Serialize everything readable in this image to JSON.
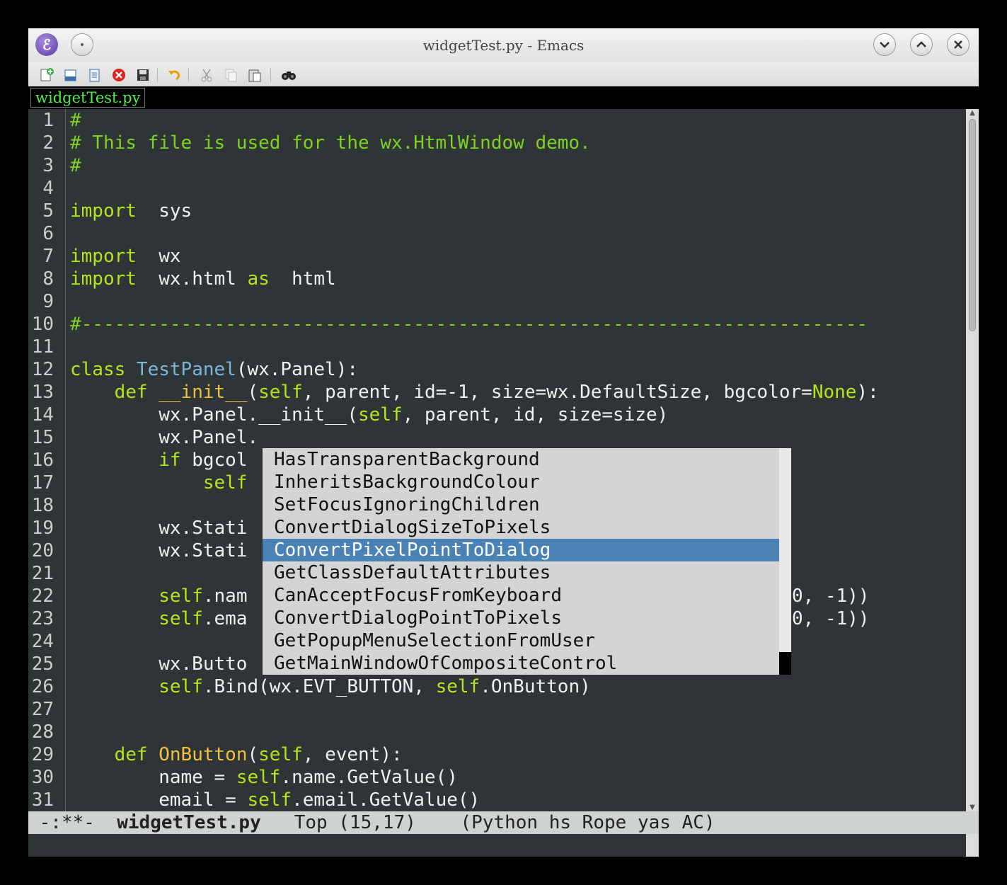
{
  "window": {
    "title": "widgetTest.py - Emacs"
  },
  "toolbar": {
    "icons": [
      "new-file-icon",
      "open-file-icon",
      "open-directory-icon",
      "close-buffer-icon",
      "save-icon",
      "undo-icon",
      "cut-icon",
      "copy-icon",
      "paste-icon",
      "search-icon"
    ]
  },
  "tab": {
    "label": "widgetTest.py"
  },
  "gutter": {
    "numbers": [
      "1",
      "2",
      "3",
      "4",
      "5",
      "6",
      "7",
      "8",
      "9",
      "10",
      "11",
      "12",
      "13",
      "14",
      "15",
      "16",
      "17",
      "18",
      "19",
      "20",
      "21",
      "22",
      "23",
      "24",
      "25",
      "26",
      "27",
      "28",
      "29",
      "30",
      "31"
    ]
  },
  "code": {
    "l1": "#",
    "l2": "# This file is used for the wx.HtmlWindow demo.",
    "l3": "#",
    "l5_kw": "import",
    "l5_rest": "  sys",
    "l7_kw": "import",
    "l7_rest": "  wx",
    "l8_kw": "import",
    "l8_mid": "  wx.html ",
    "l8_as": "as",
    "l8_rest": "  html",
    "l10": "#-----------------------------------------------------------------------",
    "l12_kw": "class ",
    "l12_cls": "TestPanel",
    "l12_rest": "(wx.Panel):",
    "l13_indent": "    ",
    "l13_def": "def ",
    "l13_fn": "__init__",
    "l13_p1": "(",
    "l13_self": "self",
    "l13_p2": ", parent, id=-1, size=wx.DefaultSize, bgcolor=",
    "l13_none": "None",
    "l13_p3": "):",
    "l14_a": "        wx.Panel.__init__(",
    "l14_self": "self",
    "l14_b": ", parent, id, size=size)",
    "l15": "        wx.Panel.",
    "l16_indent": "        ",
    "l16_kw": "if",
    "l16_rest": " bgcol",
    "l17_indent": "            ",
    "l17_self": "self",
    "l19": "        wx.Stati",
    "l20": "        wx.Stati",
    "l22_indent": "        ",
    "l22_self": "self",
    "l22_rest": ".nam",
    "l22_tail": "0, -1))",
    "l23_indent": "        ",
    "l23_self": "self",
    "l23_rest": ".ema",
    "l23_tail": "0, -1))",
    "l25": "        wx.Butto",
    "l26_indent": "        ",
    "l26_self1": "self",
    "l26_mid": ".Bind(wx.EVT_BUTTON, ",
    "l26_self2": "self",
    "l26_rest": ".OnButton)",
    "l29_indent": "    ",
    "l29_def": "def ",
    "l29_fn": "OnButton",
    "l29_p1": "(",
    "l29_self": "self",
    "l29_p2": ", event):",
    "l30_a": "        name = ",
    "l30_self": "self",
    "l30_b": ".name.GetValue()",
    "l31_a": "        email = ",
    "l31_self": "self",
    "l31_b": ".email.GetValue()"
  },
  "completion": {
    "selected_index": 4,
    "candidates": [
      "HasTransparentBackground",
      "InheritsBackgroundColour",
      "SetFocusIgnoringChildren",
      "ConvertDialogSizeToPixels",
      "ConvertPixelPointToDialog",
      "GetClassDefaultAttributes",
      "CanAcceptFocusFromKeyboard",
      "ConvertDialogPointToPixels",
      "GetPopupMenuSelectionFromUser",
      "GetMainWindowOfCompositeControl"
    ]
  },
  "modeline": {
    "status": " -:**-  ",
    "buffer": "widgetTest.py",
    "position": "   Top (15,17)    ",
    "modes": "(Python hs Rope yas AC)"
  },
  "colors": {
    "background": "#2f3436",
    "comment": "#7ed321",
    "keyword": "#b5e61d",
    "function": "#f0c040",
    "class": "#7ab6d8",
    "selection": "#4a82b5"
  }
}
